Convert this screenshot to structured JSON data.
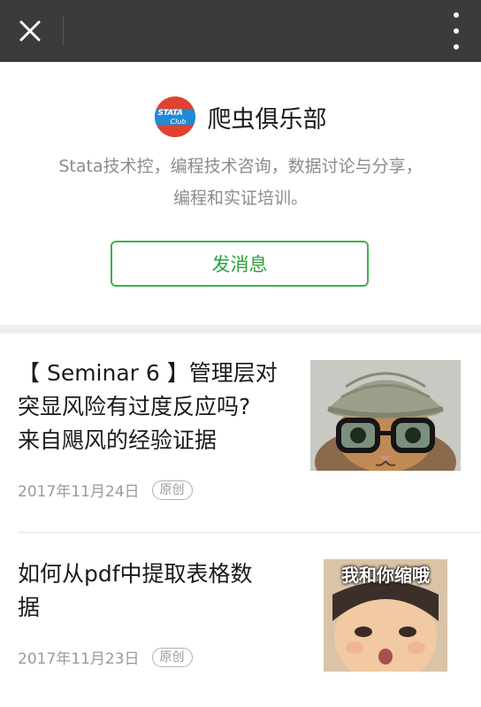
{
  "topbar": {
    "close_icon": "close-icon",
    "more_icon": "more-vertical-icon"
  },
  "profile": {
    "logo_text_1": "STATA",
    "logo_text_2": "Club",
    "name": "爬虫俱乐部",
    "description_line1": "Stata技术控，编程技术咨询，数据讨论与分享，",
    "description_line2": "编程和实证培训。",
    "message_button": "发消息"
  },
  "articles": [
    {
      "title_line1": "【 Seminar 6 】管理层对",
      "title_line2": "突显风险有过度反应吗?",
      "title_line3": "来自飓风的经验证据",
      "date": "2017年11月24日",
      "badge": "原创"
    },
    {
      "title_line1": "如何从pdf中提取表格数",
      "title_line2": "据",
      "date": "2017年11月23日",
      "badge": "原创",
      "thumb_caption": "我和你缩哦"
    }
  ],
  "colors": {
    "accent_green": "#3bb34a",
    "topbar": "#3b3b3b"
  }
}
